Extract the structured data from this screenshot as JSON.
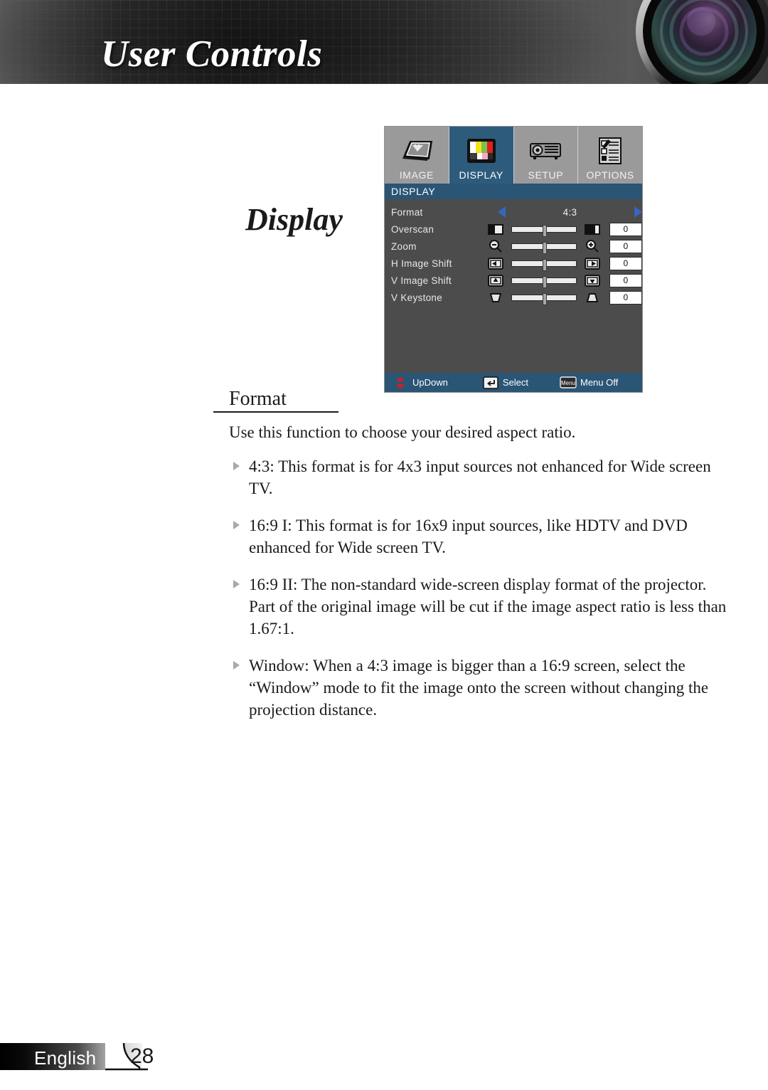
{
  "header": {
    "title": "User Controls",
    "lens_icon": "camera-lens-icon"
  },
  "page_heading": "Display",
  "osd": {
    "tabs": [
      {
        "label": "IMAGE",
        "icon": "image-keystone-icon",
        "active": false
      },
      {
        "label": "DISPLAY",
        "icon": "color-bars-icon",
        "active": true
      },
      {
        "label": "SETUP",
        "icon": "projector-icon",
        "active": false
      },
      {
        "label": "OPTIONS",
        "icon": "options-checklist-icon",
        "active": false
      }
    ],
    "section_title": "DISPLAY",
    "format_row": {
      "label": "Format",
      "value": "4:3",
      "left_arrow_icon": "arrow-left-icon",
      "right_arrow_icon": "arrow-right-icon"
    },
    "slider_rows": [
      {
        "label": "Overscan",
        "value": "0",
        "left_icon": "overscan-small-icon",
        "right_icon": "overscan-large-icon",
        "thumb_pct": 50
      },
      {
        "label": "Zoom",
        "value": "0",
        "left_icon": "zoom-out-icon",
        "right_icon": "zoom-in-icon",
        "thumb_pct": 50
      },
      {
        "label": "H Image Shift",
        "value": "0",
        "left_icon": "shift-left-icon",
        "right_icon": "shift-right-icon",
        "thumb_pct": 50
      },
      {
        "label": "V Image Shift",
        "value": "0",
        "left_icon": "shift-up-icon",
        "right_icon": "shift-down-icon",
        "thumb_pct": 50
      },
      {
        "label": "V Keystone",
        "value": "0",
        "left_icon": "keystone-down-icon",
        "right_icon": "keystone-up-icon",
        "thumb_pct": 50
      }
    ],
    "footer_items": [
      {
        "label": "UpDown",
        "icon": "updown-arrows-icon"
      },
      {
        "label": "Select",
        "icon": "enter-key-icon"
      },
      {
        "label": "Menu Off",
        "icon": "menu-key-icon"
      }
    ],
    "colors": {
      "panel_bg": "#4c4c4c",
      "tab_bg": "#9a9a9a",
      "tab_active_bg": "#2d5b7c",
      "section_bg": "#2a5575",
      "footer_bg": "#2a5575",
      "arrow_blue": "#3566c0",
      "updown_red": "#cc1f2a"
    }
  },
  "content": {
    "section_heading": "Format",
    "intro": "Use this function to choose your desired aspect ratio.",
    "bullets": [
      "4:3: This format is for 4x3 input sources not enhanced for Wide screen TV.",
      "16:9 I: This format is for 16x9 input sources, like HDTV and DVD enhanced for Wide screen TV.",
      "16:9 II: The non-standard wide-screen display format of the projector. Part of the original image will be cut if the image aspect ratio is less than 1.67:1.",
      "Window: When a 4:3 image is bigger than a 16:9 screen, select the “Window” mode to fit the image onto the screen without changing the projection distance."
    ]
  },
  "footer": {
    "language": "English",
    "page_number": "28"
  }
}
